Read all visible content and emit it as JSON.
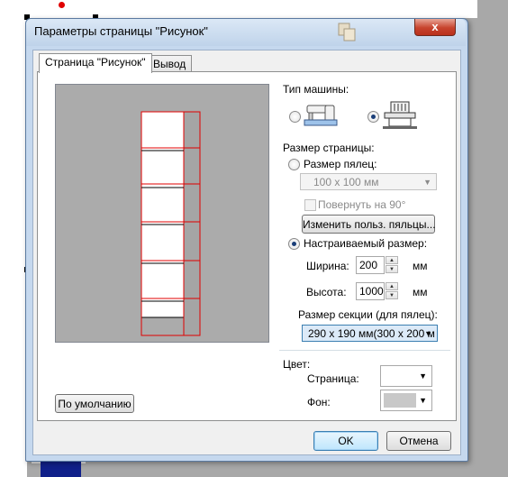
{
  "window": {
    "title": "Параметры страницы \"Рисунок\"",
    "close_glyph": "x"
  },
  "tabs": [
    {
      "label": "Страница \"Рисунок\""
    },
    {
      "label": "Вывод"
    }
  ],
  "machine": {
    "label": "Тип машины:",
    "options": [
      {
        "name": "sewing-machine",
        "selected": false
      },
      {
        "name": "embroidery-machine",
        "selected": true
      }
    ]
  },
  "page_size": {
    "label": "Размер страницы:",
    "hoop_option_label": "Размер пялец:",
    "hoop_value": "100 x 100 мм",
    "rotate_label": "Повернуть на 90°",
    "edit_hoops_button": "Изменить польз. пяльцы...",
    "custom_option_label": "Настраиваемый размер:",
    "width_label": "Ширина:",
    "width_value": "200",
    "height_label": "Высота:",
    "height_value": "1000",
    "unit": "мм",
    "section_label": "Размер секции (для пялец):",
    "section_value": "290 x 190 мм(300 x 200 м"
  },
  "color": {
    "label": "Цвет:",
    "page_label": "Страница:",
    "page_color": "#ffffff",
    "background_label": "Фон:",
    "background_color": "#c8c8c8"
  },
  "buttons": {
    "defaults": "По умолчанию",
    "ok": "OK",
    "cancel": "Отмена"
  }
}
